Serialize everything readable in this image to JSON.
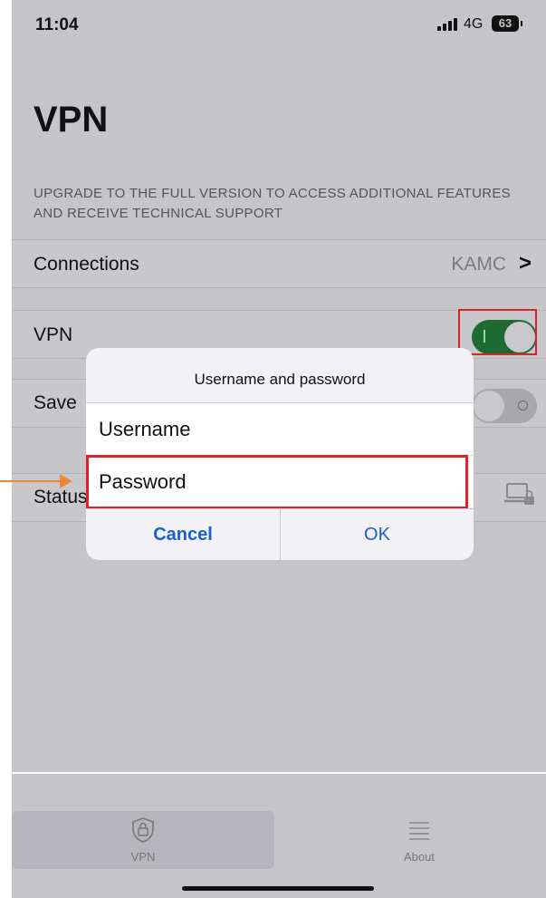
{
  "status_bar": {
    "time": "11:04",
    "network": "4G",
    "battery": "63"
  },
  "header": {
    "title": "VPN",
    "notice": "UPGRADE TO THE FULL VERSION TO ACCESS ADDITIONAL FEATURES AND RECEIVE TECHNICAL SUPPORT"
  },
  "settings": {
    "connections": {
      "label": "Connections",
      "value": "KAMC",
      "chevron": ">"
    },
    "vpn": {
      "label": "VPN",
      "enabled": true
    },
    "save": {
      "label": "Save",
      "enabled": false
    },
    "status": {
      "label": "Status",
      "icon": "computer-lock-icon"
    }
  },
  "dialog": {
    "title": "Username and password",
    "username_placeholder": "Username",
    "password_placeholder": "Password",
    "cancel_label": "Cancel",
    "ok_label": "OK"
  },
  "tabs": [
    {
      "label": "VPN",
      "icon": "shield-lock-icon",
      "selected": true
    },
    {
      "label": "About",
      "icon": "list-icon",
      "selected": false
    }
  ],
  "colors": {
    "toggle_on": "#1e6b32",
    "highlight": "#e0202a",
    "arrow": "#e8893a",
    "button_text": "#1a5fd0"
  }
}
